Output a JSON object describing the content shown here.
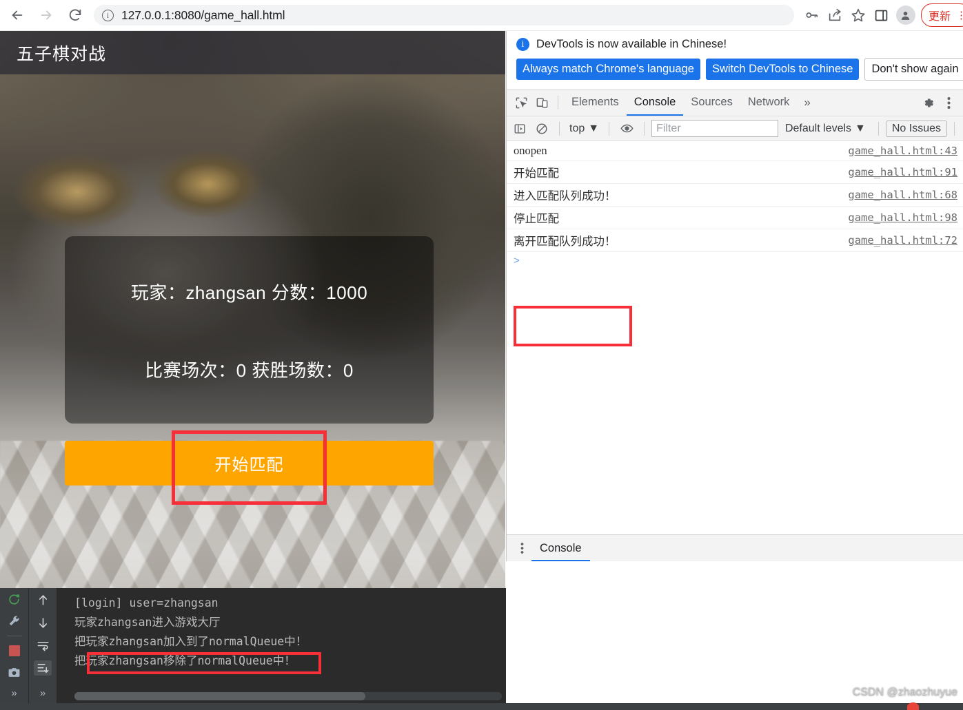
{
  "browser": {
    "back_label": "back-arrow",
    "forward_label": "forward-arrow",
    "reload_label": "reload",
    "url_host": "127.0.0.1:8080",
    "url_path": "/game_hall.html",
    "url_full": "127.0.0.1:8080/game_hall.html",
    "info_glyph": "i",
    "update_button": "更新",
    "update_dots": "⋮"
  },
  "page": {
    "header_title": "五子棋对战",
    "player_line": "玩家：zhangsan 分数：1000",
    "stats_line": "比赛场次：0 获胜场数：0",
    "match_button": "开始匹配",
    "button_color": "#ffa500"
  },
  "devtools": {
    "banner": {
      "message": "DevTools is now available in Chinese!",
      "info_glyph": "i",
      "btn_always": "Always match Chrome's language",
      "btn_switch": "Switch DevTools to Chinese",
      "btn_dismiss": "Don't show again"
    },
    "tabs": [
      {
        "label": "Elements",
        "active": false
      },
      {
        "label": "Console",
        "active": true
      },
      {
        "label": "Sources",
        "active": false
      },
      {
        "label": "Network",
        "active": false
      }
    ],
    "tabs_overflow": "»",
    "filterbar": {
      "context": "top",
      "context_caret": "▼",
      "filter_placeholder": "Filter",
      "filter_value": "",
      "levels": "Default levels",
      "levels_caret": "▼",
      "issues": "No Issues"
    },
    "console_logs": [
      {
        "message": "onopen",
        "source": "game_hall.html:43",
        "highlighted": false
      },
      {
        "message": "开始匹配",
        "source": "game_hall.html:91",
        "highlighted": false
      },
      {
        "message": "进入匹配队列成功！",
        "source": "game_hall.html:68",
        "highlighted": false
      },
      {
        "message": "停止匹配",
        "source": "game_hall.html:98",
        "highlighted": true
      },
      {
        "message": "离开匹配队列成功！",
        "source": "game_hall.html:72",
        "highlighted": true
      }
    ],
    "prompt_caret": ">",
    "drawer_tab": "Console",
    "drawer_kebab": "⋮"
  },
  "terminal": {
    "lines": [
      {
        "text": "[login] user=zhangsan",
        "highlighted": false
      },
      {
        "text": "玩家zhangsan进入游戏大厅",
        "highlighted": false
      },
      {
        "text": "把玩家zhangsan加入到了normalQueue中！",
        "highlighted": false
      },
      {
        "text": "把玩家zhangsan移除了normalQueue中！",
        "highlighted": true
      }
    ],
    "gutter_more": "»"
  },
  "watermark": "CSDN @zhaozhuyue",
  "annotation_color": "#f72f38"
}
